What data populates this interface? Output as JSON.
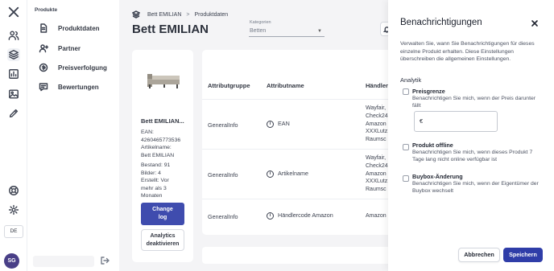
{
  "rail": {
    "icons": [
      "logo-icon",
      "users-icon",
      "layers-icon",
      "bar-chart-icon",
      "image-icon",
      "pen-icon",
      "support-icon",
      "settings-icon"
    ],
    "language": "DE",
    "avatar_initials": "SG"
  },
  "subnav": {
    "title": "Produkte",
    "items": [
      {
        "label": "Produktdaten",
        "icon": "document-icon"
      },
      {
        "label": "Partner",
        "icon": "add-user-icon"
      },
      {
        "label": "Preisverfolgung",
        "icon": "price-tag-icon"
      },
      {
        "label": "Bewertungen",
        "icon": "chat-icon"
      }
    ]
  },
  "breadcrumb": {
    "items": [
      "Bett EMILIAN",
      "Produktdaten"
    ],
    "separator": ">"
  },
  "page_title": "Bett EMILIAN",
  "category": {
    "label": "Kategorien",
    "value": "Betten"
  },
  "product": {
    "name": "Bett EMILIAN...",
    "ean_label": "EAN:",
    "ean": "4260465773536",
    "article_label": "Artikelname:",
    "article": "Bett EMILIAN",
    "stock": "Bestand: 91",
    "images": "Bilder: 4",
    "created_line1": "Erstellt: Vor",
    "created_line2": "mehr als 3",
    "created_line3": "Monaten",
    "changelog_line1": "Change",
    "changelog_line2": "log",
    "analytics_line1": "Analytics",
    "analytics_line2": "deaktivieren"
  },
  "table": {
    "headers": [
      "Attributgruppe",
      "Attributname",
      "Händler"
    ],
    "rows": [
      {
        "group": "GeneralInfo",
        "name": "EAN",
        "merchants": [
          "Wayfair,",
          "Check24",
          "Amazon",
          "XXXLutz,",
          "Raumsc"
        ]
      },
      {
        "group": "GeneralInfo",
        "name": "Artikelname",
        "merchants": [
          "Wayfair,",
          "Check24",
          "Amazon",
          "XXXLutz,",
          "Raumsc"
        ]
      },
      {
        "group": "GeneralInfo",
        "name": "Händlercode Amazon",
        "merchants": [
          "Amazon"
        ]
      }
    ]
  },
  "drawer": {
    "title": "Benachrichtigungen",
    "description": "Verwalten Sie, wann Sie Benachrichtigungen für dieses einzelne Produkt erhalten. Diese Einstellungen überschreiben die allgemeinen Einstellungen.",
    "section": "Analytik",
    "options": [
      {
        "title": "Preisgrenze",
        "description": "Benachrichtigen Sie mich, wenn der Preis darunter fällt"
      },
      {
        "title": "Produkt offline",
        "description": "Benachrichtigen Sie mich, wenn dieses Produkt 7 Tage lang nicht online verfügbar ist"
      },
      {
        "title": "Buybox-Änderung",
        "description": "Benachrichtigen Sie mich, wenn der Eigentümer der Buybox wechselt"
      }
    ],
    "price_input_value": "€",
    "cancel_label": "Abbrechen",
    "save_label": "Speichern"
  },
  "colors": {
    "primary": "#2f3da8",
    "background": "#f3f4f6",
    "avatar": "#3a2f7d"
  }
}
